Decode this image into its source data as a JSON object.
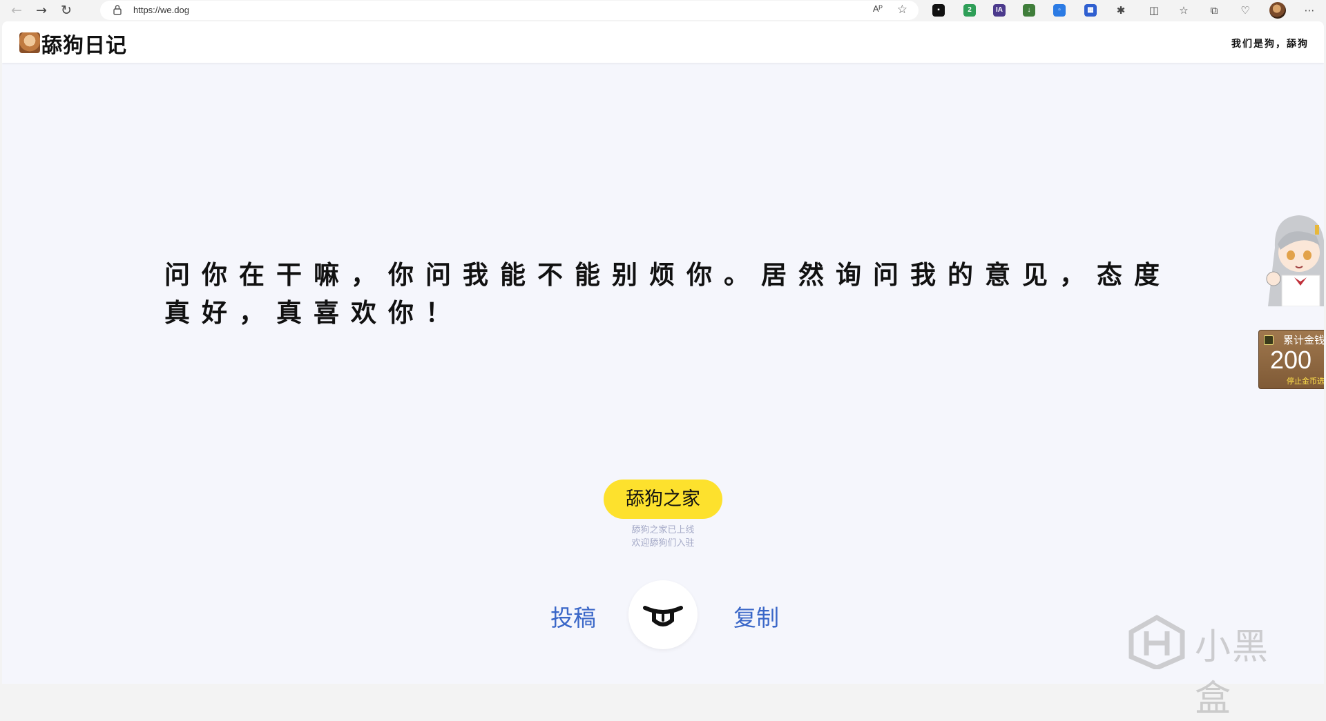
{
  "browser": {
    "url": "https://we.dog",
    "read_aloud_label": "Aᴾ",
    "extensions": [
      {
        "name": "extension-black-icon",
        "color": "#111111",
        "glyph": "■"
      },
      {
        "name": "extension-shield-icon",
        "color": "#2e9e57",
        "glyph": "2"
      },
      {
        "name": "extension-ia-icon",
        "color": "#4b3a8c",
        "glyph": "IA"
      },
      {
        "name": "extension-download-icon",
        "color": "#3f7d3a",
        "glyph": "↓"
      },
      {
        "name": "extension-blue-icon",
        "color": "#2b7be4",
        "glyph": "□"
      },
      {
        "name": "extension-grid-icon",
        "color": "#2f5fd0",
        "glyph": "▦"
      }
    ]
  },
  "site": {
    "logo_text": "舔狗日记",
    "slogan": "我们是狗，舔狗"
  },
  "quote": {
    "text": "问你在干嘛，你问我能不能别烦你。居然询问我的意见，态度真好，真喜欢你！"
  },
  "home": {
    "button_label": "舔狗之家",
    "notice_line1": "舔狗之家已上线",
    "notice_line2": "欢迎舔狗们入驻"
  },
  "actions": {
    "submit_label": "投稿",
    "copy_label": "复制"
  },
  "coin_widget": {
    "title": "累计金钱",
    "count": "200",
    "stop_label": "停止金币选"
  },
  "watermark": {
    "text": "小黑盒"
  },
  "colors": {
    "accent_yellow": "#fde12d",
    "link_blue": "#3a67c8",
    "page_bg": "#f5f6fc"
  }
}
